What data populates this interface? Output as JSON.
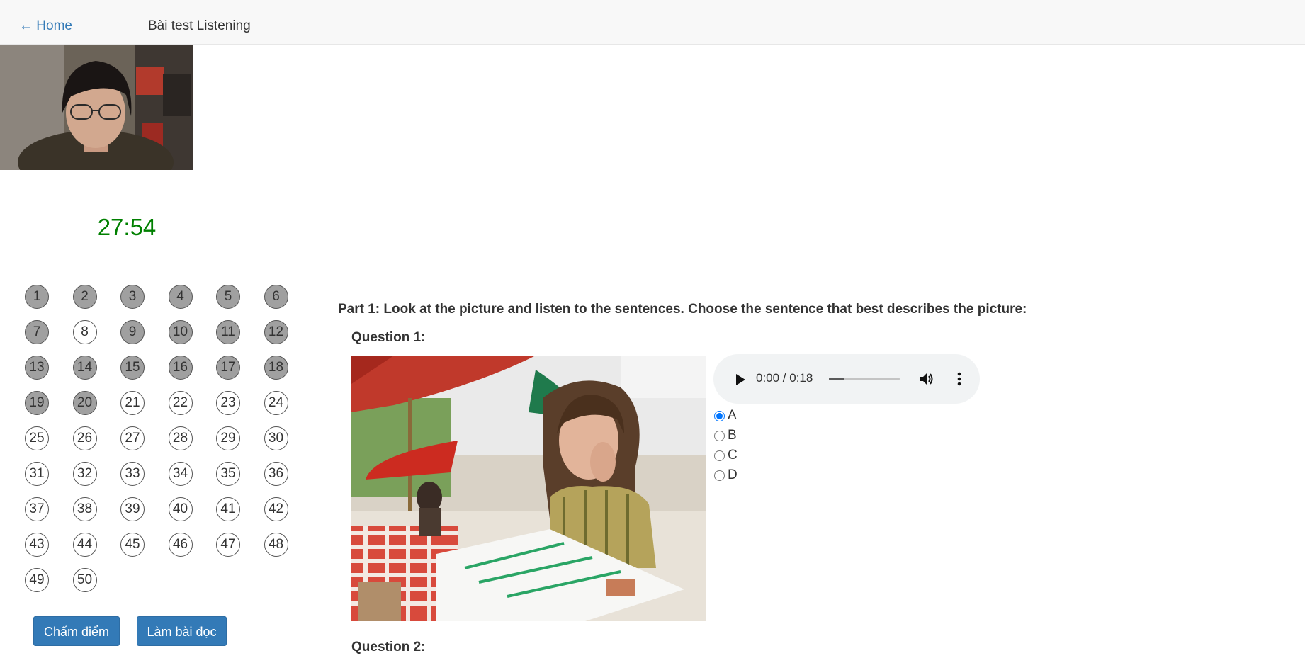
{
  "nav": {
    "home_label": "← Home",
    "title": "Bài test Listening"
  },
  "timer": "27:54",
  "question_nav": [
    {
      "n": "1",
      "answered": true
    },
    {
      "n": "2",
      "answered": true
    },
    {
      "n": "3",
      "answered": true
    },
    {
      "n": "4",
      "answered": true
    },
    {
      "n": "5",
      "answered": true
    },
    {
      "n": "6",
      "answered": true
    },
    {
      "n": "7",
      "answered": true
    },
    {
      "n": "8",
      "answered": false
    },
    {
      "n": "9",
      "answered": true
    },
    {
      "n": "10",
      "answered": true
    },
    {
      "n": "11",
      "answered": true
    },
    {
      "n": "12",
      "answered": true
    },
    {
      "n": "13",
      "answered": true
    },
    {
      "n": "14",
      "answered": true
    },
    {
      "n": "15",
      "answered": true
    },
    {
      "n": "16",
      "answered": true
    },
    {
      "n": "17",
      "answered": true
    },
    {
      "n": "18",
      "answered": true
    },
    {
      "n": "19",
      "answered": true
    },
    {
      "n": "20",
      "answered": true
    },
    {
      "n": "21",
      "answered": false
    },
    {
      "n": "22",
      "answered": false
    },
    {
      "n": "23",
      "answered": false
    },
    {
      "n": "24",
      "answered": false
    },
    {
      "n": "25",
      "answered": false
    },
    {
      "n": "26",
      "answered": false
    },
    {
      "n": "27",
      "answered": false
    },
    {
      "n": "28",
      "answered": false
    },
    {
      "n": "29",
      "answered": false
    },
    {
      "n": "30",
      "answered": false
    },
    {
      "n": "31",
      "answered": false
    },
    {
      "n": "32",
      "answered": false
    },
    {
      "n": "33",
      "answered": false
    },
    {
      "n": "34",
      "answered": false
    },
    {
      "n": "35",
      "answered": false
    },
    {
      "n": "36",
      "answered": false
    },
    {
      "n": "37",
      "answered": false
    },
    {
      "n": "38",
      "answered": false
    },
    {
      "n": "39",
      "answered": false
    },
    {
      "n": "40",
      "answered": false
    },
    {
      "n": "41",
      "answered": false
    },
    {
      "n": "42",
      "answered": false
    },
    {
      "n": "43",
      "answered": false
    },
    {
      "n": "44",
      "answered": false
    },
    {
      "n": "45",
      "answered": false
    },
    {
      "n": "46",
      "answered": false
    },
    {
      "n": "47",
      "answered": false
    },
    {
      "n": "48",
      "answered": false
    },
    {
      "n": "49",
      "answered": false
    },
    {
      "n": "50",
      "answered": false
    }
  ],
  "buttons": {
    "grade": "Chấm điểm",
    "reading": "Làm bài đọc"
  },
  "part1": {
    "title": "Part 1: Look at the picture and listen to the sentences. Choose the sentence that best describes the picture:",
    "question1": {
      "label": "Question 1:",
      "audio": {
        "time": "0:00 / 0:18",
        "progress": 0.22
      },
      "options": [
        {
          "label": "A",
          "checked": true
        },
        {
          "label": "B",
          "checked": false
        },
        {
          "label": "C",
          "checked": false
        },
        {
          "label": "D",
          "checked": false
        }
      ]
    },
    "question2": {
      "label": "Question 2:"
    }
  },
  "colors": {
    "accent": "#337ab7",
    "timer": "#008000",
    "answered": "#a0a0a0"
  },
  "icons": {
    "play": "play-icon",
    "volume": "volume-icon",
    "more": "more-vert-icon"
  }
}
